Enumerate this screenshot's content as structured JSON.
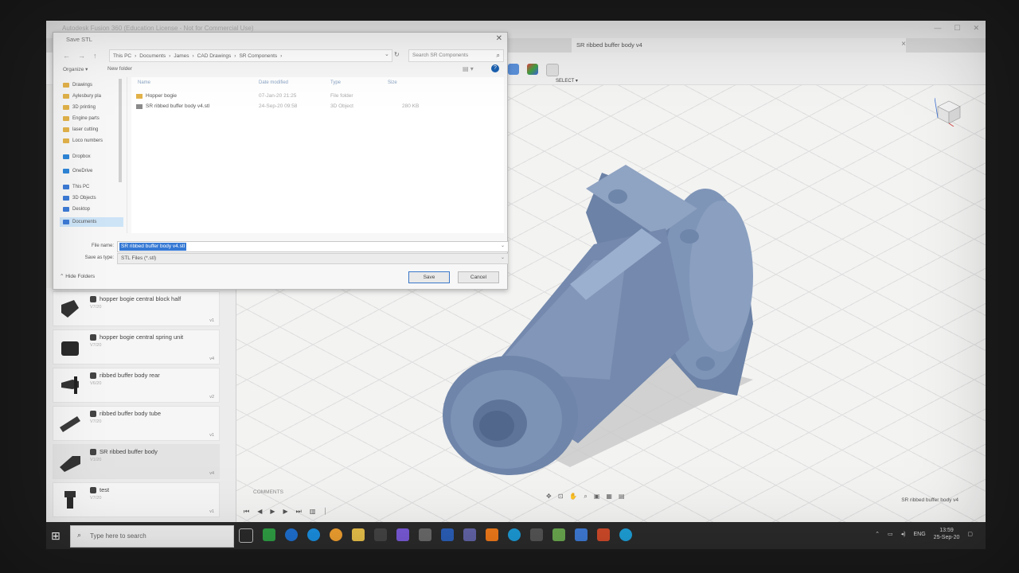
{
  "app": {
    "title": "Autodesk Fusion 360 (Education License - Not for Commercial Use)",
    "document_tab": "SR ribbed buffer body v4",
    "toolbar_select": "SELECT ▾"
  },
  "dialog": {
    "title": "Save STL",
    "breadcrumb": [
      "This PC",
      "Documents",
      "James",
      "CAD Drawings",
      "SR Components"
    ],
    "search_placeholder": "Search SR Components",
    "organize": "Organize ▾",
    "new_folder": "New folder",
    "nav_items": [
      {
        "label": "Drawings",
        "icon": "folder"
      },
      {
        "label": "Aylesbury pla",
        "icon": "folder"
      },
      {
        "label": "3D printing",
        "icon": "folder"
      },
      {
        "label": "Engine parts",
        "icon": "folder"
      },
      {
        "label": "laser cutting",
        "icon": "folder"
      },
      {
        "label": "Loco numbers",
        "icon": "folder"
      },
      {
        "label": "Dropbox",
        "icon": "dropbox"
      },
      {
        "label": "OneDrive",
        "icon": "cloud"
      },
      {
        "label": "This PC",
        "icon": "pc"
      },
      {
        "label": "3D Objects",
        "icon": "folder-blue"
      },
      {
        "label": "Desktop",
        "icon": "folder-blue"
      },
      {
        "label": "Documents",
        "icon": "folder-blue"
      }
    ],
    "columns": {
      "name": "Name",
      "date": "Date modified",
      "type": "Type",
      "size": "Size"
    },
    "files": [
      {
        "name": "Hopper bogie",
        "date": "07-Jan-20 21:25",
        "type": "File folder",
        "size": ""
      },
      {
        "name": "SR ribbed buffer body v4.stl",
        "date": "24-Sep-20 09:58",
        "type": "3D Object",
        "size": "280 KB"
      }
    ],
    "file_name_label": "File name:",
    "file_name_value": "SR ribbed buffer body v4.stl",
    "save_type_label": "Save as type:",
    "save_type_value": "STL Files (*.stl)",
    "hide_folders": "Hide Folders",
    "save": "Save",
    "cancel": "Cancel"
  },
  "data_panel": {
    "items": [
      {
        "name": "hopper bogie central block half",
        "version": "V7/20"
      },
      {
        "name": "hopper bogie central spring unit",
        "version": "V7/20"
      },
      {
        "name": "ribbed buffer body rear",
        "version": "V6/20"
      },
      {
        "name": "ribbed buffer body tube",
        "version": "V7/20"
      },
      {
        "name": "SR ribbed buffer body",
        "version": "V1/20"
      },
      {
        "name": "test",
        "version": "V7/20"
      }
    ],
    "badges": [
      "v1",
      "v4",
      "v2",
      "v1",
      "v4",
      "v1"
    ]
  },
  "viewport": {
    "comments": "COMMENTS",
    "doc_label": "SR ribbed buffer body v4"
  },
  "taskbar": {
    "search_placeholder": "Type here to search",
    "language": "ENG",
    "time": "13:59",
    "date": "25-Sep-20"
  },
  "colors": {
    "part": "#7f95b8",
    "accent": "#3478d4"
  }
}
